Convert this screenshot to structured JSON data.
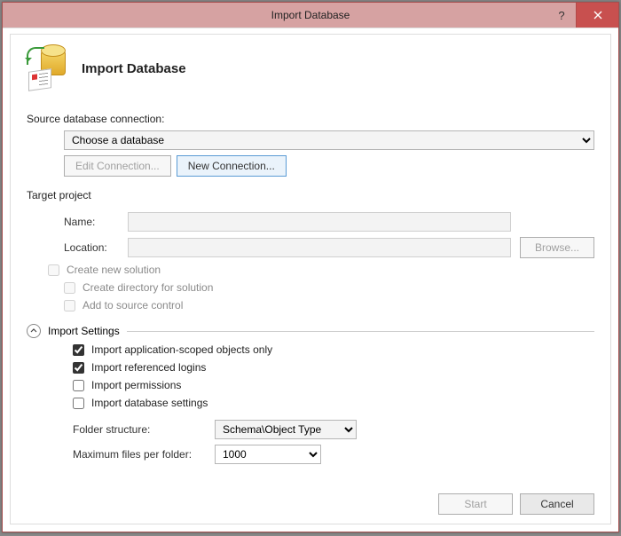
{
  "window": {
    "title": "Import Database"
  },
  "header": {
    "heading": "Import Database"
  },
  "source": {
    "label": "Source database connection:",
    "combo_value": "Choose a database",
    "edit_btn": "Edit Connection...",
    "new_btn": "New Connection..."
  },
  "target": {
    "label": "Target project",
    "name_label": "Name:",
    "name_value": "",
    "location_label": "Location:",
    "location_value": "",
    "browse_btn": "Browse...",
    "create_solution": "Create new solution",
    "create_dir": "Create directory for solution",
    "add_source_control": "Add to source control"
  },
  "import": {
    "label": "Import Settings",
    "app_scoped": "Import application-scoped objects only",
    "ref_logins": "Import referenced logins",
    "permissions": "Import permissions",
    "db_settings": "Import database settings",
    "folder_label": "Folder structure:",
    "folder_value": "Schema\\Object Type",
    "max_files_label": "Maximum files per folder:",
    "max_files_value": "1000"
  },
  "footer": {
    "start": "Start",
    "cancel": "Cancel"
  }
}
